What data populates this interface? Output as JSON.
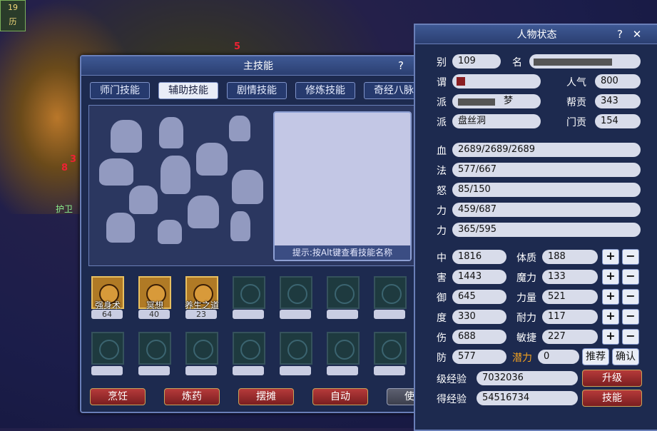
{
  "background": {
    "hud_top": "19",
    "hud_bottom": "历",
    "floating_numbers": [
      "5",
      "8",
      "3"
    ],
    "ground_text": "护卫"
  },
  "skill_window": {
    "title": "主技能",
    "help_label": "?",
    "close_label": "✕",
    "tabs": [
      "师门技能",
      "辅助技能",
      "剧情技能",
      "修炼技能",
      "奇经八脉"
    ],
    "active_tab": "辅助技能",
    "hint": "提示:按Alt键查看技能名称",
    "skills": [
      {
        "name": "强身术",
        "level": "64"
      },
      {
        "name": "冥想",
        "level": "40"
      },
      {
        "name": "养生之道",
        "level": "23"
      }
    ],
    "buttons": [
      "烹饪",
      "炼药",
      "摆摊",
      "自动",
      "使用"
    ]
  },
  "status_window": {
    "title": "人物状态",
    "help_label": "?",
    "close_label": "✕",
    "level_label": "别",
    "level": "109",
    "name_label": "名",
    "title_label": "谓",
    "popularity_label": "人气",
    "popularity": "800",
    "sect_label": "派",
    "sect_name_fragment": "梦",
    "contribution_label": "帮贡",
    "contribution": "343",
    "faction_label": "派",
    "faction": "盘丝洞",
    "faction_contrib_label": "门贡",
    "faction_contrib": "154",
    "hp_label": "血",
    "hp": "2689/2689/2689",
    "mp_label": "法",
    "mp": "577/667",
    "anger_label": "怒",
    "anger": "85/150",
    "vigor_label": "力",
    "vigor": "459/687",
    "energy_label": "力",
    "energy": "365/595",
    "attrs_left": [
      {
        "label": "中",
        "value": "1816"
      },
      {
        "label": "害",
        "value": "1443"
      },
      {
        "label": "御",
        "value": "645"
      },
      {
        "label": "度",
        "value": "330"
      },
      {
        "label": "伤",
        "value": "688"
      },
      {
        "label": "防",
        "value": "577"
      }
    ],
    "attrs_right": [
      {
        "label": "体质",
        "value": "188"
      },
      {
        "label": "魔力",
        "value": "133"
      },
      {
        "label": "力量",
        "value": "521"
      },
      {
        "label": "耐力",
        "value": "117"
      },
      {
        "label": "敏捷",
        "value": "227"
      }
    ],
    "potential_label": "潜力",
    "potential": "0",
    "recommend_label": "推荐",
    "confirm_label": "确认",
    "plus": "+",
    "minus": "−",
    "level_exp_label": "级经验",
    "level_exp": "7032036",
    "gained_exp_label": "得经验",
    "gained_exp": "54516734",
    "upgrade_label": "升级",
    "skill_label": "技能",
    "accent_color": "#f0a020"
  }
}
